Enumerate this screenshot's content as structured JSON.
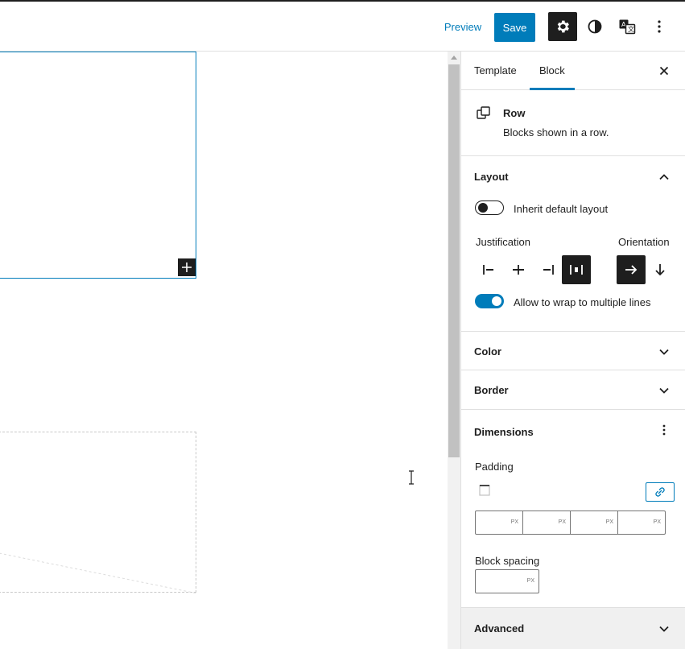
{
  "header": {
    "preview_label": "Preview",
    "save_label": "Save",
    "icons": [
      "settings-icon",
      "styles-contrast-icon",
      "translate-icon",
      "more-vertical-icon"
    ],
    "accent_color": "#007cba"
  },
  "sidebar": {
    "tabs": [
      {
        "label": "Template",
        "active": false
      },
      {
        "label": "Block",
        "active": true
      }
    ],
    "block": {
      "name": "Row",
      "description": "Blocks shown in a row."
    },
    "layout": {
      "title": "Layout",
      "expanded": true,
      "inherit_label": "Inherit default layout",
      "inherit_on": false,
      "justification_label": "Justification",
      "justification_options": [
        "justify-left",
        "justify-center",
        "justify-right",
        "justify-space-between"
      ],
      "justification_selected": "justify-space-between",
      "orientation_label": "Orientation",
      "orientation_options": [
        "horizontal",
        "vertical"
      ],
      "orientation_selected": "horizontal",
      "wrap_label": "Allow to wrap to multiple lines",
      "wrap_on": true
    },
    "color": {
      "title": "Color"
    },
    "border": {
      "title": "Border"
    },
    "dimensions": {
      "title": "Dimensions",
      "padding_label": "Padding",
      "padding_unit": "PX",
      "padding_values": [
        "",
        "",
        "",
        ""
      ],
      "block_spacing_label": "Block spacing",
      "block_spacing_unit": "PX",
      "block_spacing_value": ""
    },
    "advanced": {
      "title": "Advanced"
    }
  }
}
